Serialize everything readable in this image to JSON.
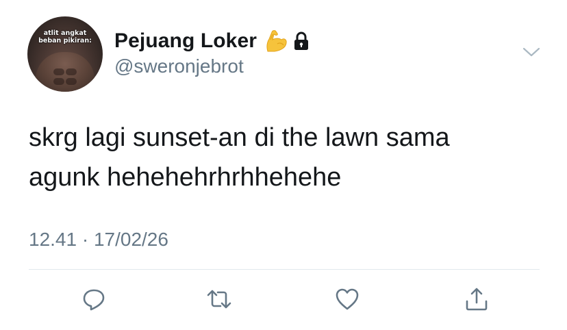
{
  "author": {
    "avatar_caption_line1": "atlit angkat",
    "avatar_caption_line2": "beban pikiran:",
    "display_name": "Pejuang Loker",
    "badge_icons": [
      "flexed-biceps-emoji",
      "lock-icon"
    ],
    "handle": "@sweronjebrot"
  },
  "tweet": {
    "text_line1": "skrg lagi sunset-an di the lawn sama",
    "text_line2": "agunk hehehehrhrhhehehe",
    "timestamp": "12.41 · 17/02/26"
  },
  "actions": {
    "icons": [
      "reply-icon",
      "retweet-icon",
      "like-icon",
      "share-icon"
    ]
  },
  "colors": {
    "primary_text": "#14171a",
    "secondary_text": "#657786",
    "divider": "#e1e8ed",
    "icon": "#657786"
  }
}
